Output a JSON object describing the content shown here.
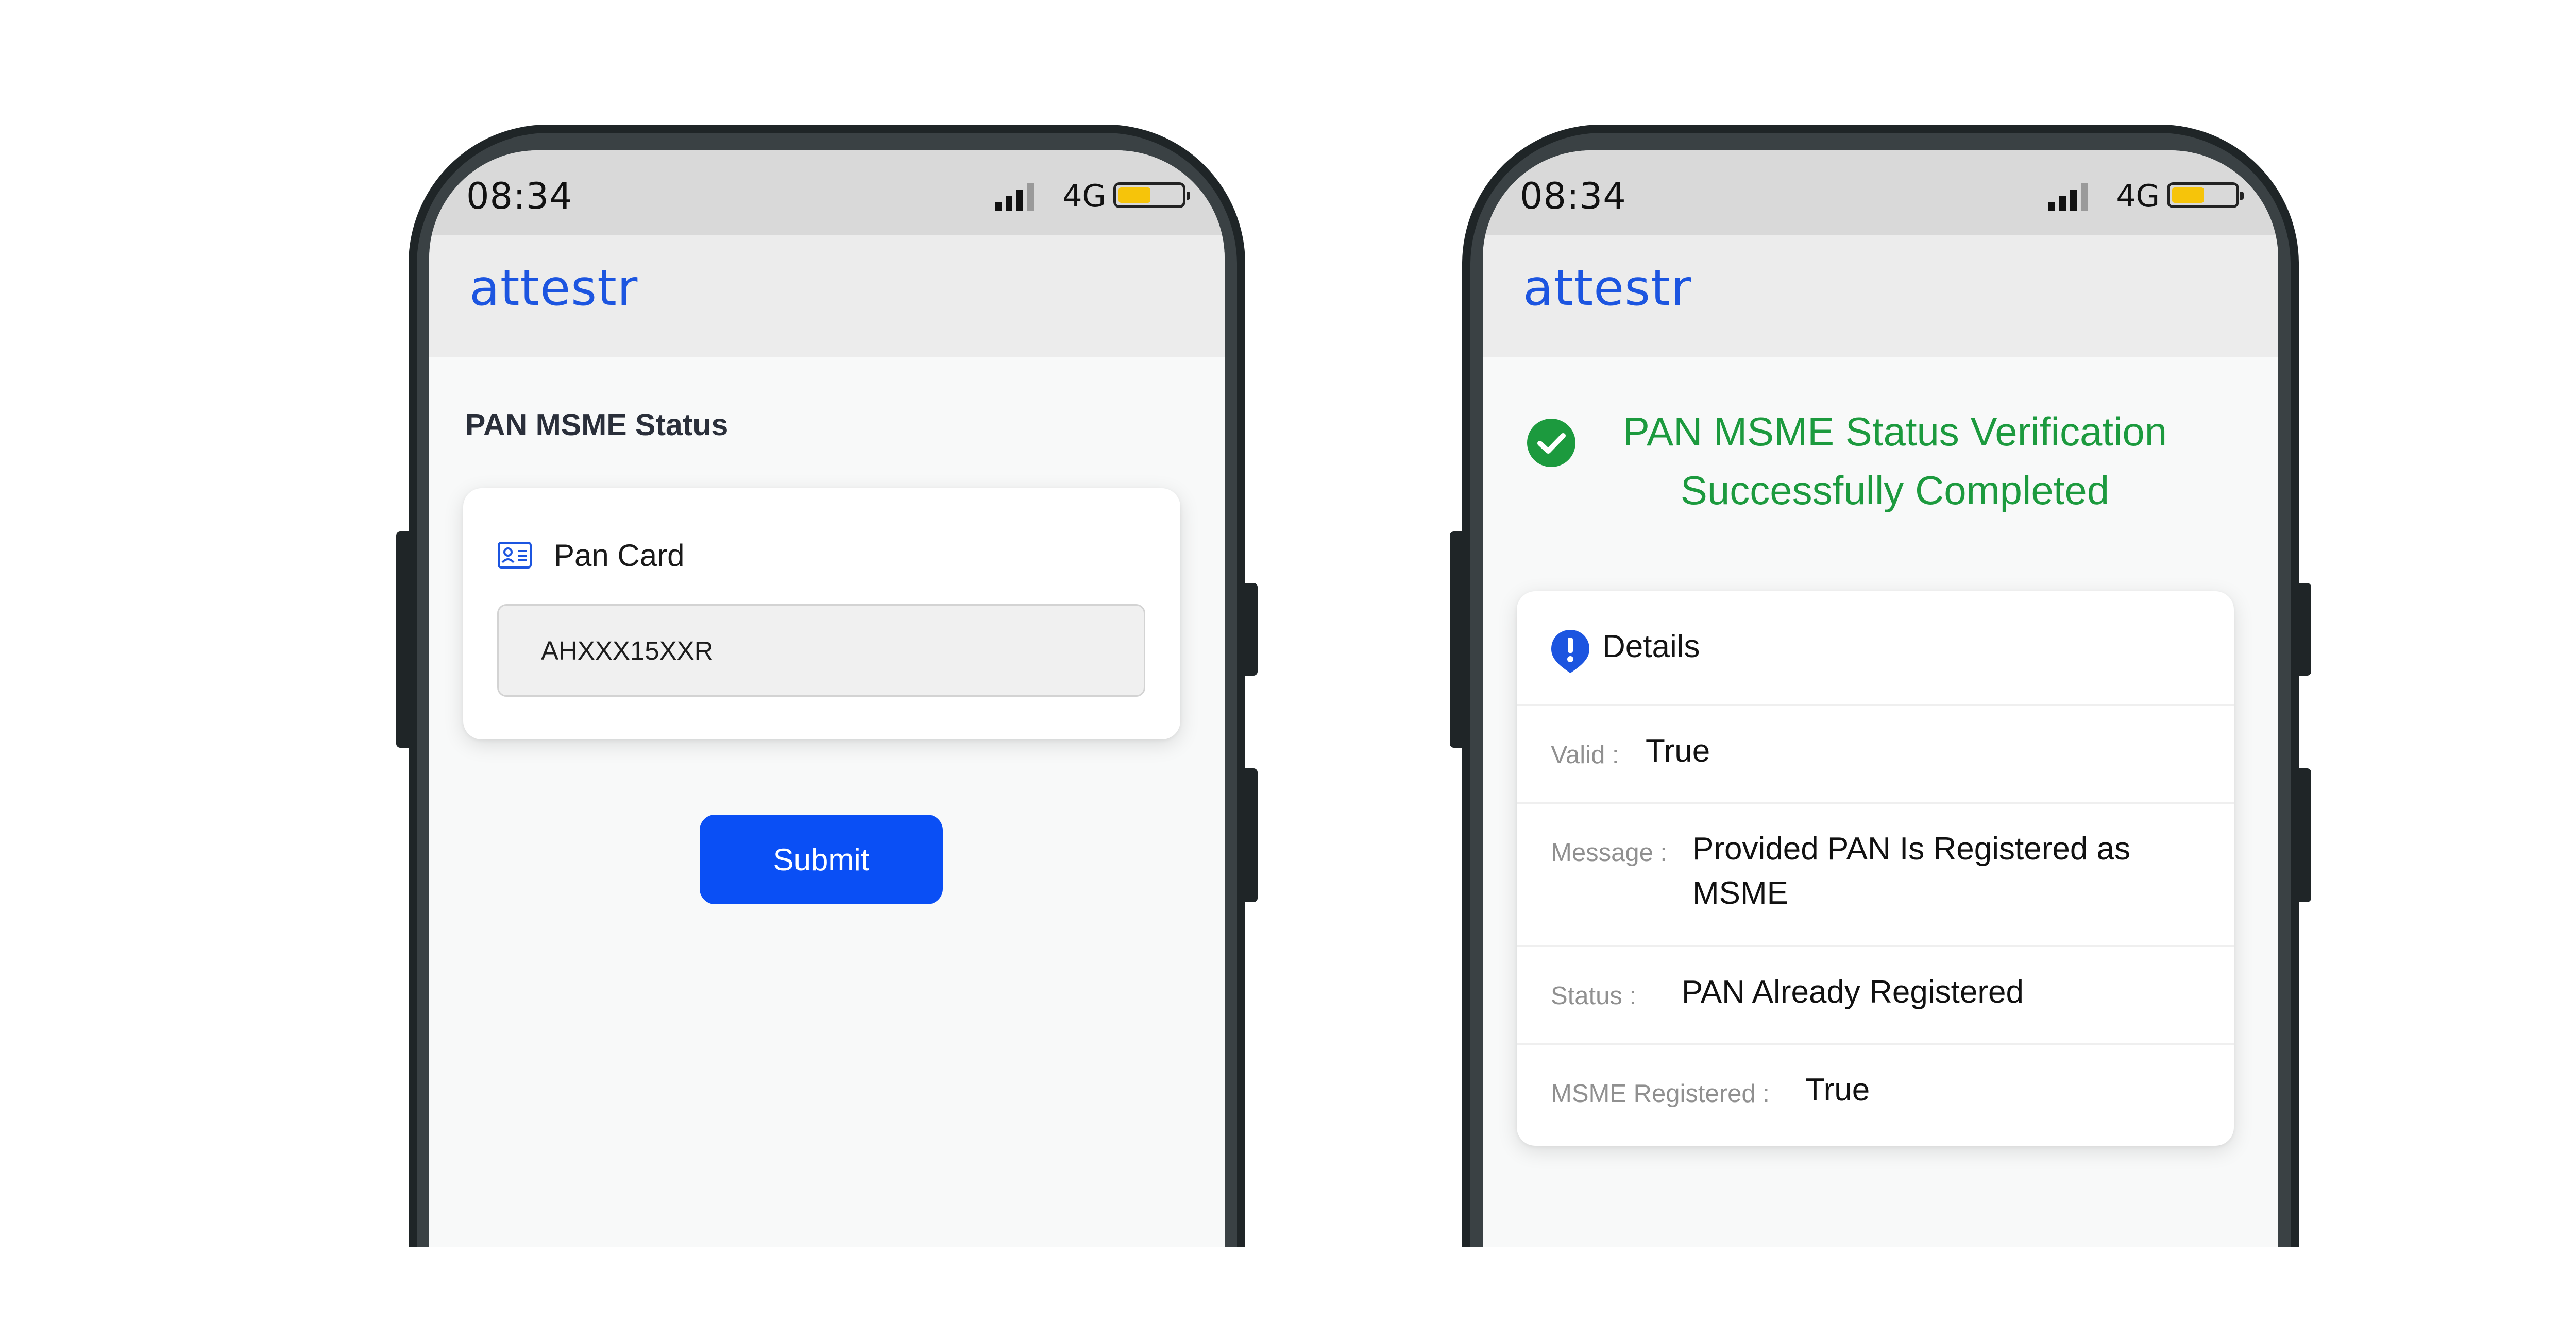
{
  "status_bar": {
    "time": "08:34",
    "network": "4G",
    "battery_level": 0.48
  },
  "app": {
    "brand": "attestr"
  },
  "form_screen": {
    "title": "PAN MSME Status",
    "field_label": "Pan Card",
    "field_value": "AHXXX15XXR",
    "submit_label": "Submit"
  },
  "result_screen": {
    "success_title": "PAN MSME Status Verification Successfully Completed",
    "details_label": "Details",
    "rows": [
      {
        "key": "Valid :",
        "value": "True"
      },
      {
        "key": "Message :",
        "value": "Provided PAN Is Registered as MSME"
      },
      {
        "key": "Status :",
        "value": "PAN Already Registered"
      },
      {
        "key": "MSME Registered :",
        "value": "True"
      }
    ]
  },
  "colors": {
    "brand_blue": "#1c55e0",
    "button_blue": "#0a4ff5",
    "success_green": "#1c9a3e",
    "battery_yellow": "#f6c40a"
  }
}
